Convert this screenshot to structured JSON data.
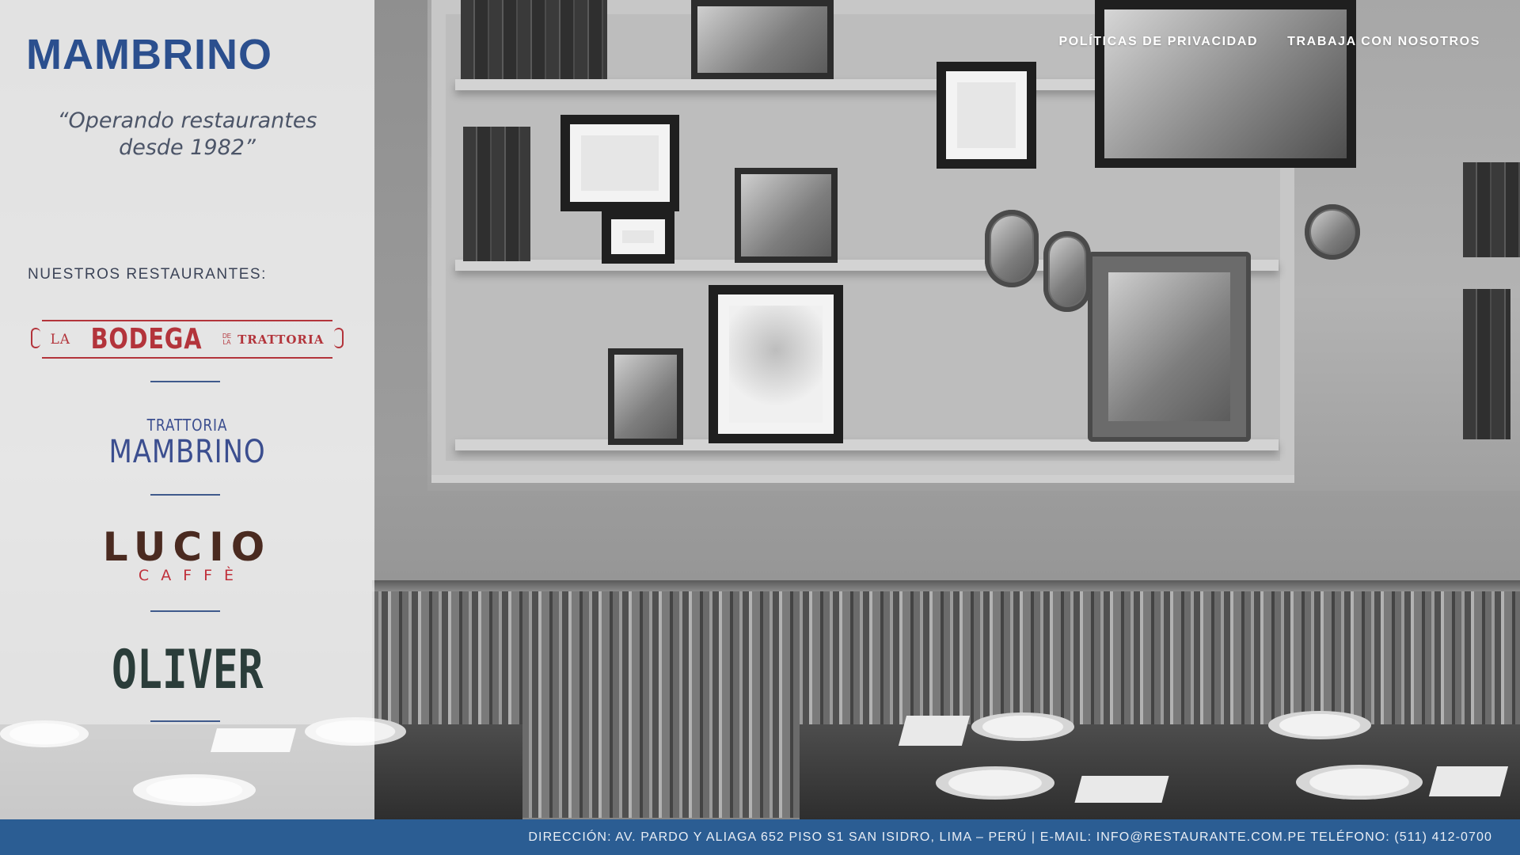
{
  "site": {
    "logo_text": "MAMBRINO",
    "tagline_line1": "“Operando restaurantes",
    "tagline_line2": "desde 1982”"
  },
  "nav": {
    "items": [
      {
        "label": "POLÍTICAS DE PRIVACIDAD"
      },
      {
        "label": "TRABAJA CON NOSOTROS"
      }
    ]
  },
  "restaurants": {
    "title": "NUESTROS RESTAURANTES:",
    "bodega": {
      "la": "LA",
      "name": "BODEGA",
      "de_la_1": "DE",
      "de_la_2": "LA",
      "trattoria": "TRATTORIA"
    },
    "trattoria_mambrino": {
      "top": "TRATTORIA",
      "name": "MAMBRINO"
    },
    "lucio": {
      "name": "LUCIO",
      "sub": "CAFFÈ"
    },
    "oliver": {
      "name": "OLIVER"
    }
  },
  "footer": {
    "text": "DIRECCIÓN: AV. PARDO Y ALIAGA 652 PISO S1 SAN ISIDRO, LIMA – PERÚ | E-MAIL: INFO@RESTAURANTE.COM.PE  TELÉFONO: (511) 412-0700"
  },
  "colors": {
    "brand_blue": "#2b4f8e",
    "footer_blue": "#2b5d93",
    "bodega_red": "#b3343b",
    "lucio_brown": "#4a2a20",
    "oliver_green": "#2b3d3a"
  }
}
